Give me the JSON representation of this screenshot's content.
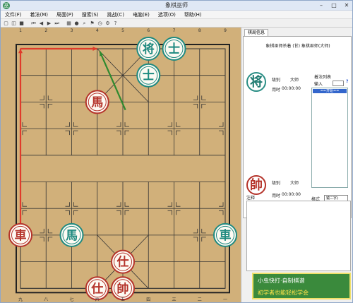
{
  "window": {
    "title": "象棋巫师",
    "app_icon": "巫"
  },
  "menu": [
    "文件(F)",
    "着法(M)",
    "局面(P)",
    "搜索(S)",
    "挑战(C)",
    "电脑(E)",
    "选项(O)",
    "帮助(H)"
  ],
  "top_files": [
    "1",
    "2",
    "3",
    "4",
    "5",
    "6",
    "7",
    "8",
    "9"
  ],
  "bottom_files": [
    "九",
    "八",
    "七",
    "六",
    "五",
    "四",
    "三",
    "二",
    "一"
  ],
  "pieces": [
    {
      "char": "将",
      "side": "black",
      "file": 5,
      "rank": 0
    },
    {
      "char": "士",
      "side": "black",
      "file": 6,
      "rank": 0
    },
    {
      "char": "士",
      "side": "black",
      "file": 5,
      "rank": 1
    },
    {
      "char": "馬",
      "side": "red",
      "file": 3,
      "rank": 2
    },
    {
      "char": "車",
      "side": "red",
      "file": 0,
      "rank": 7
    },
    {
      "char": "馬",
      "side": "black",
      "file": 2,
      "rank": 7
    },
    {
      "char": "車",
      "side": "black",
      "file": 8,
      "rank": 7
    },
    {
      "char": "仕",
      "side": "red",
      "file": 4,
      "rank": 8
    },
    {
      "char": "仕",
      "side": "red",
      "file": 3,
      "rank": 9
    },
    {
      "char": "帥",
      "side": "red",
      "file": 4,
      "rank": 9
    }
  ],
  "arrows": [
    {
      "color": "#e03a2a",
      "from": {
        "file": 0,
        "rank": 7
      },
      "to": {
        "file": 0,
        "rank": 0
      }
    },
    {
      "color": "#e03a2a",
      "from": {
        "file": 0,
        "rank": 0
      },
      "to": {
        "file": 3,
        "rank": 0
      }
    },
    {
      "color": "#2f8a2f",
      "from": {
        "file": 4.1,
        "rank": 2.3
      },
      "to": {
        "file": 3.1,
        "rank": 0.1
      }
    }
  ],
  "panel": {
    "tab": "棋局信息",
    "game_title": "象棋巫师杀着 (甘) 象棋巫师(大师)",
    "black_piece": "将",
    "red_piece": "帥",
    "level_label": "级别",
    "level_value": "大师",
    "time_label": "用时",
    "time_value": "00:00:00",
    "moves_title": "着法列表",
    "input_label": "输入",
    "help_mark": "?",
    "first_move": "==开始==",
    "format_label": "格式",
    "format_value": "镜二字)"
  },
  "comment_label": "注释",
  "ad": {
    "line1": "小虫快打·自制棋谱",
    "line2": "初学者也能轻松学会"
  }
}
